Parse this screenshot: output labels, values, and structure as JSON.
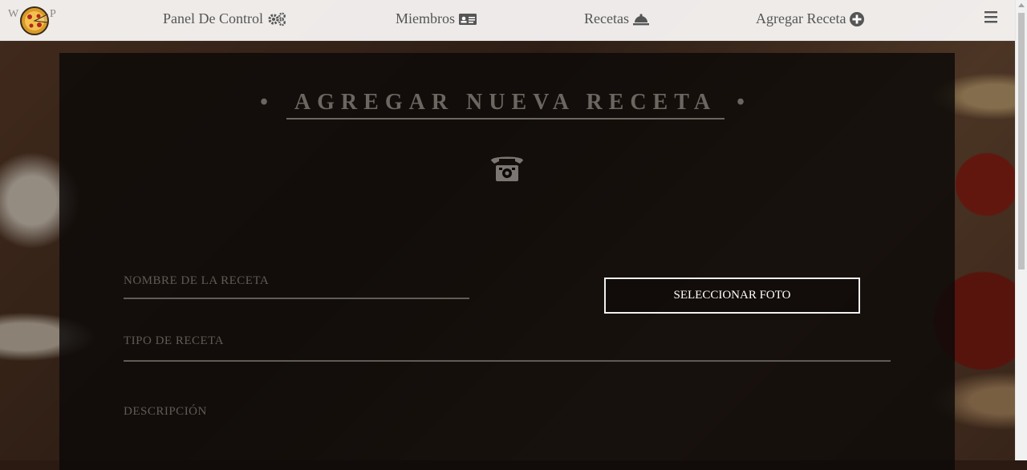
{
  "nav": {
    "logo_left": "W",
    "logo_right": "P",
    "items": [
      {
        "label": "Panel De Control",
        "icon": "gears-icon"
      },
      {
        "label": "Miembros",
        "icon": "id-card-icon"
      },
      {
        "label": "Recetas",
        "icon": "bell-cloche-icon"
      },
      {
        "label": "Agregar Receta",
        "icon": "plus-circle-icon"
      }
    ],
    "menu_icon": "hamburger-icon"
  },
  "form": {
    "title_dot_left": "•",
    "title": "AGREGAR NUEVA RECETA",
    "title_dot_right": "•",
    "header_icon": "old-telephone-icon",
    "recipe_name_label": "NOMBRE DE LA RECETA",
    "recipe_type_label": "TIPO DE RECETA",
    "description_label": "DESCRIPCIÓN",
    "select_photo_button": "SELECCIONAR FOTO"
  },
  "colors": {
    "nav_bg": "#f5f3f1",
    "panel_bg": "#0c0a09",
    "label_text": "#5f5b55",
    "button_border": "#f0f0f0"
  }
}
